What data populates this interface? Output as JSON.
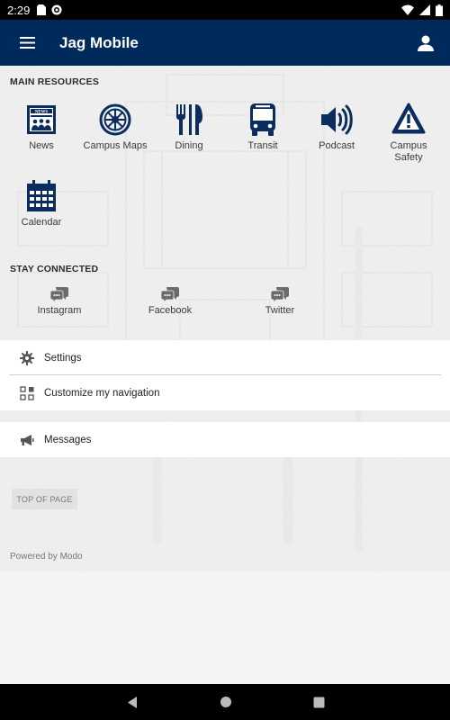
{
  "status": {
    "time": "2:29"
  },
  "app": {
    "title": "Jag Mobile"
  },
  "main_resources": {
    "label": "MAIN RESOURCES",
    "items": [
      {
        "label": "News",
        "icon": "newspaper-icon"
      },
      {
        "label": "Campus Maps",
        "icon": "wheel-icon"
      },
      {
        "label": "Dining",
        "icon": "fork-knife-icon"
      },
      {
        "label": "Transit",
        "icon": "bus-icon"
      },
      {
        "label": "Podcast",
        "icon": "speaker-icon"
      },
      {
        "label": "Campus Safety",
        "label_lines": [
          "Campus",
          "Safety"
        ],
        "icon": "warning-icon"
      },
      {
        "label": "Calendar",
        "icon": "calendar-icon"
      }
    ]
  },
  "stay_connected": {
    "label": "STAY CONNECTED",
    "items": [
      {
        "label": "Instagram",
        "icon": "chat-bubbles-icon"
      },
      {
        "label": "Facebook",
        "icon": "chat-bubbles-icon"
      },
      {
        "label": "Twitter",
        "icon": "chat-bubbles-icon"
      }
    ]
  },
  "menu": {
    "settings": "Settings",
    "customize": "Customize my navigation",
    "messages": "Messages"
  },
  "footer": {
    "top_of_page": "TOP OF PAGE",
    "powered_by": "Powered by Modo"
  },
  "colors": {
    "primary": "#002a5c",
    "icon": "#0b2d5e"
  }
}
